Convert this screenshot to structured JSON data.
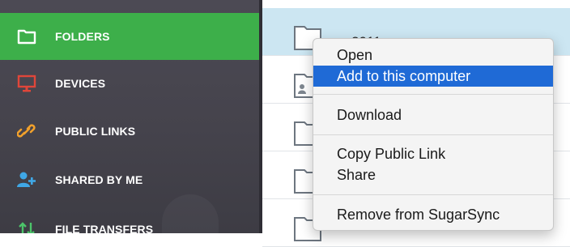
{
  "sidebar": {
    "items": [
      {
        "label": "FOLDERS",
        "icon": "folder-icon",
        "active": true
      },
      {
        "label": "DEVICES",
        "icon": "monitor-icon",
        "active": false
      },
      {
        "label": "PUBLIC LINKS",
        "icon": "link-icon",
        "active": false
      },
      {
        "label": "SHARED BY ME",
        "icon": "add-user-icon",
        "active": false
      },
      {
        "label": "FILE TRANSFERS",
        "icon": "transfer-arrows-icon",
        "active": false
      }
    ]
  },
  "file_list": {
    "rows": [
      {
        "name": "2011",
        "selected": true
      },
      {
        "name": ""
      },
      {
        "name": ""
      },
      {
        "name": ""
      },
      {
        "name": ""
      }
    ]
  },
  "context_menu": {
    "items": [
      "Open",
      "Add to this computer",
      "Download",
      "Copy Public Link",
      "Share",
      "Remove from SugarSync"
    ],
    "highlighted": "Add to this computer"
  },
  "colors": {
    "sidebar_bg": "#47454e",
    "active_green": "#3daf4a",
    "selection_blue": "#cce6f2",
    "menu_highlight": "#1f6ad6",
    "devices_red": "#e0463a",
    "links_orange": "#f0a02c",
    "shared_blue": "#3fa7e6",
    "transfers_green": "#4cc46a"
  }
}
